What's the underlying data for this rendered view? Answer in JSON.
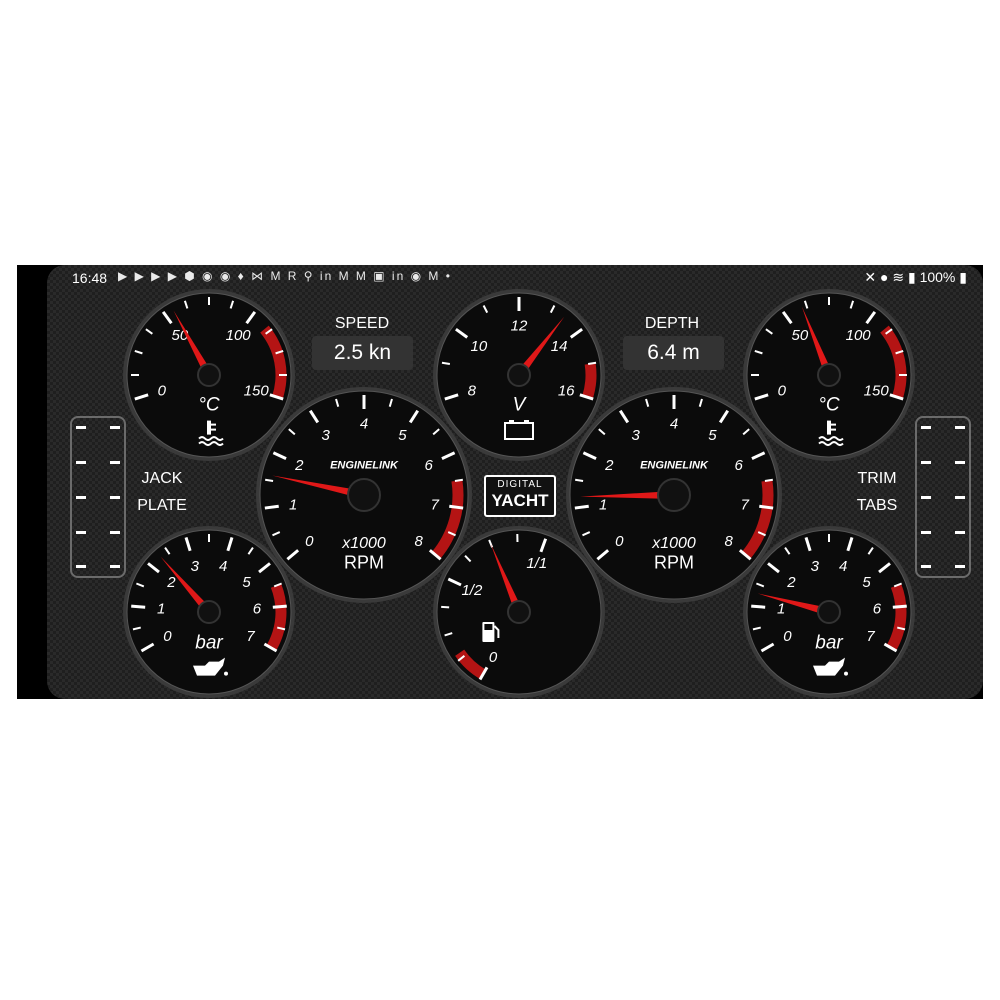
{
  "status_bar": {
    "time": "16:48",
    "notification_icons": [
      "youtube-icon",
      "youtube-icon",
      "youtube-icon",
      "youtube-icon",
      "app-icon",
      "app-icon",
      "app-icon",
      "app-icon",
      "app-icon",
      "gmail-icon",
      "app-icon",
      "app-icon",
      "linkedin-icon",
      "gmail-icon",
      "gmail-icon",
      "app-icon",
      "linkedin-icon",
      "app-icon",
      "gmail-icon",
      "dot-icon"
    ],
    "right_icons": [
      "mute-icon",
      "location-icon",
      "wifi-icon",
      "signal-icon"
    ],
    "battery": "100%"
  },
  "readouts": {
    "speed_label": "SPEED",
    "speed_value": "2.5 kn",
    "depth_label": "DEPTH",
    "depth_value": "6.4 m"
  },
  "side_labels": {
    "left_line1": "JACK",
    "left_line2": "PLATE",
    "right_line1": "TRIM",
    "right_line2": "TABS"
  },
  "brand": {
    "top": "DIGITAL",
    "bottom": "YACHT"
  },
  "gauges": [
    {
      "id": "temp-left",
      "unit": "°C",
      "icon": "coolant-temp-icon",
      "ticks": [
        "0",
        "50",
        "100",
        "150"
      ],
      "min": 0,
      "max": 150,
      "value": 55,
      "redzone": [
        110,
        150
      ]
    },
    {
      "id": "voltage",
      "unit": "V",
      "icon": "battery-icon",
      "ticks": [
        "8",
        "10",
        "12",
        "14",
        "16"
      ],
      "min": 8,
      "max": 16,
      "value": 13.4,
      "redzone": [
        15,
        16
      ]
    },
    {
      "id": "temp-right",
      "unit": "°C",
      "icon": "coolant-temp-icon",
      "ticks": [
        "0",
        "50",
        "100",
        "150"
      ],
      "min": 0,
      "max": 150,
      "value": 60,
      "redzone": [
        110,
        150
      ]
    },
    {
      "id": "rpm-left",
      "unit": "RPM",
      "multiplier": "x1000",
      "brand": "ENGINELINK",
      "ticks": [
        "0",
        "1",
        "2",
        "3",
        "4",
        "5",
        "6",
        "7",
        "8"
      ],
      "min": 0,
      "max": 8,
      "value": 1.6,
      "redzone": [
        6.5,
        8
      ]
    },
    {
      "id": "rpm-right",
      "unit": "RPM",
      "multiplier": "x1000",
      "brand": "ENGINELINK",
      "ticks": [
        "0",
        "1",
        "2",
        "3",
        "4",
        "5",
        "6",
        "7",
        "8"
      ],
      "min": 0,
      "max": 8,
      "value": 1.2,
      "redzone": [
        6.5,
        8
      ]
    },
    {
      "id": "oil-left",
      "unit": "bar",
      "icon": "oil-pressure-icon",
      "ticks": [
        "0",
        "1",
        "2",
        "3",
        "4",
        "5",
        "6",
        "7"
      ],
      "min": 0,
      "max": 7,
      "value": 2.3,
      "redzone": [
        5.5,
        7
      ]
    },
    {
      "id": "fuel",
      "unit": "",
      "icon": "fuel-icon",
      "ticks": [
        "0",
        "1/2",
        "1/1"
      ],
      "min": 0,
      "max": 1,
      "value": 0.75,
      "redzone": [
        0,
        0.15
      ]
    },
    {
      "id": "oil-right",
      "unit": "bar",
      "icon": "oil-pressure-icon",
      "ticks": [
        "0",
        "1",
        "2",
        "3",
        "4",
        "5",
        "6",
        "7"
      ],
      "min": 0,
      "max": 7,
      "value": 1.3,
      "redzone": [
        5.5,
        7
      ]
    }
  ]
}
